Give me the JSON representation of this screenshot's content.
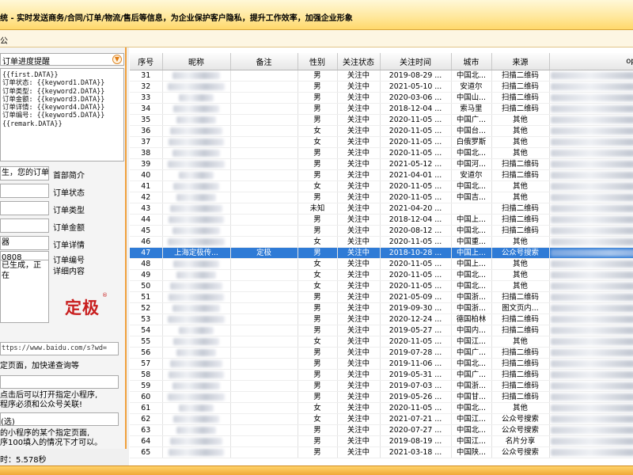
{
  "window": {
    "title": "统 - 实时发送商务/合同/订单/物流/售后等信息，为企业保护客户隐私，提升工作效率，加强企业形象",
    "menu_label": "公"
  },
  "template": {
    "selected": "订单进度提醒",
    "content": "{{first.DATA}}\n订单状态: {{keyword1.DATA}}\n订单类型: {{keyword2.DATA}}\n订单金额: {{keyword3.DATA}}\n订单详情: {{keyword4.DATA}}\n订单编号: {{keyword5.DATA}}\n{{remark.DATA}}"
  },
  "form": {
    "fields": [
      {
        "value": "生，您的订单",
        "label": "首部简介"
      },
      {
        "value": "",
        "label": "订单状态"
      },
      {
        "value": "",
        "label": "订单类型"
      },
      {
        "value": "",
        "label": "订单金额"
      },
      {
        "value": "器",
        "label": "订单详情"
      },
      {
        "value": "0808",
        "label": "订单编号"
      }
    ],
    "detail_value": "已生成，正在",
    "detail_label": "详细内容",
    "url": "ttps://www.baidu.com/s?wd=",
    "url_hint": "定页面，加快递查询等",
    "miniprogram_hint1": "点击后可以打开指定小程序,",
    "miniprogram_hint2": "程序必须和公众号关联!",
    "optional_label": "(选)",
    "page_hint1": "的小程序的某个指定页面,",
    "page_hint2": "序100填入的情况下才可以。"
  },
  "logo": {
    "text": "定极",
    "reg": "®"
  },
  "status": {
    "text": "时：5.578秒"
  },
  "table": {
    "columns": [
      "序号",
      "昵称",
      "备注",
      "性别",
      "关注状态",
      "关注时间",
      "城市",
      "来源",
      "openID"
    ],
    "rows": [
      {
        "id": "31",
        "nickname": "",
        "remark": "",
        "gender": "男",
        "status": "关注中",
        "time": "2019-08-29 ...",
        "city": "中国北...",
        "source": "扫描二维码",
        "selected": false
      },
      {
        "id": "32",
        "nickname": "",
        "remark": "",
        "gender": "男",
        "status": "关注中",
        "time": "2021-05-10 ...",
        "city": "安道尔",
        "source": "扫描二维码",
        "selected": false
      },
      {
        "id": "33",
        "nickname": "",
        "remark": "",
        "gender": "男",
        "status": "关注中",
        "time": "2020-03-06 ...",
        "city": "中国山...",
        "source": "扫描二维码",
        "selected": false
      },
      {
        "id": "34",
        "nickname": "",
        "remark": "",
        "gender": "男",
        "status": "关注中",
        "time": "2018-12-04 ...",
        "city": "索马里",
        "source": "扫描二维码",
        "selected": false
      },
      {
        "id": "35",
        "nickname": "",
        "remark": "",
        "gender": "男",
        "status": "关注中",
        "time": "2020-11-05 ...",
        "city": "中国广...",
        "source": "其他",
        "selected": false
      },
      {
        "id": "36",
        "nickname": "",
        "remark": "",
        "gender": "女",
        "status": "关注中",
        "time": "2020-11-05 ...",
        "city": "中国台...",
        "source": "其他",
        "selected": false
      },
      {
        "id": "37",
        "nickname": "",
        "remark": "",
        "gender": "女",
        "status": "关注中",
        "time": "2020-11-05 ...",
        "city": "白俄罗斯",
        "source": "其他",
        "selected": false
      },
      {
        "id": "38",
        "nickname": "",
        "remark": "",
        "gender": "男",
        "status": "关注中",
        "time": "2020-11-05 ...",
        "city": "中国北...",
        "source": "其他",
        "selected": false
      },
      {
        "id": "39",
        "nickname": "",
        "remark": "",
        "gender": "男",
        "status": "关注中",
        "time": "2021-05-12 ...",
        "city": "中国河...",
        "source": "扫描二维码",
        "selected": false
      },
      {
        "id": "40",
        "nickname": "",
        "remark": "",
        "gender": "男",
        "status": "关注中",
        "time": "2021-04-01 ...",
        "city": "安道尔",
        "source": "扫描二维码",
        "selected": false
      },
      {
        "id": "41",
        "nickname": "",
        "remark": "",
        "gender": "女",
        "status": "关注中",
        "time": "2020-11-05 ...",
        "city": "中国北...",
        "source": "其他",
        "selected": false
      },
      {
        "id": "42",
        "nickname": "",
        "remark": "",
        "gender": "男",
        "status": "关注中",
        "time": "2020-11-05 ...",
        "city": "中国吉...",
        "source": "其他",
        "selected": false
      },
      {
        "id": "43",
        "nickname": "",
        "remark": "",
        "gender": "未知",
        "status": "关注中",
        "time": "2021-04-20 ...",
        "city": "",
        "source": "扫描二维码",
        "selected": false
      },
      {
        "id": "44",
        "nickname": "",
        "remark": "",
        "gender": "男",
        "status": "关注中",
        "time": "2018-12-04 ...",
        "city": "中国上...",
        "source": "扫描二维码",
        "selected": false
      },
      {
        "id": "45",
        "nickname": "",
        "remark": "",
        "gender": "男",
        "status": "关注中",
        "time": "2020-08-12 ...",
        "city": "中国北...",
        "source": "扫描二维码",
        "selected": false
      },
      {
        "id": "46",
        "nickname": "",
        "remark": "",
        "gender": "女",
        "status": "关注中",
        "time": "2020-11-05 ...",
        "city": "中国重...",
        "source": "其他",
        "selected": false
      },
      {
        "id": "47",
        "nickname": "上海定极传...",
        "remark": "定极",
        "gender": "男",
        "status": "关注中",
        "time": "2018-10-28 ...",
        "city": "中国上...",
        "source": "公众号搜索",
        "selected": true
      },
      {
        "id": "48",
        "nickname": "",
        "remark": "",
        "gender": "女",
        "status": "关注中",
        "time": "2020-11-05 ...",
        "city": "中国上...",
        "source": "其他",
        "selected": false
      },
      {
        "id": "49",
        "nickname": "",
        "remark": "",
        "gender": "女",
        "status": "关注中",
        "time": "2020-11-05 ...",
        "city": "中国北...",
        "source": "其他",
        "selected": false
      },
      {
        "id": "50",
        "nickname": "",
        "remark": "",
        "gender": "女",
        "status": "关注中",
        "time": "2020-11-05 ...",
        "city": "中国北...",
        "source": "其他",
        "selected": false
      },
      {
        "id": "51",
        "nickname": "",
        "remark": "",
        "gender": "男",
        "status": "关注中",
        "time": "2021-05-09 ...",
        "city": "中国浙...",
        "source": "扫描二维码",
        "selected": false
      },
      {
        "id": "52",
        "nickname": "",
        "remark": "",
        "gender": "男",
        "status": "关注中",
        "time": "2019-09-30 ...",
        "city": "中国浙...",
        "source": "图文页内...",
        "selected": false
      },
      {
        "id": "53",
        "nickname": "",
        "remark": "",
        "gender": "男",
        "status": "关注中",
        "time": "2020-12-24 ...",
        "city": "德国柏林",
        "source": "扫描二维码",
        "selected": false
      },
      {
        "id": "54",
        "nickname": "",
        "remark": "",
        "gender": "男",
        "status": "关注中",
        "time": "2019-05-27 ...",
        "city": "中国内...",
        "source": "扫描二维码",
        "selected": false
      },
      {
        "id": "55",
        "nickname": "",
        "remark": "",
        "gender": "女",
        "status": "关注中",
        "time": "2020-11-05 ...",
        "city": "中国江...",
        "source": "其他",
        "selected": false
      },
      {
        "id": "56",
        "nickname": "",
        "remark": "",
        "gender": "男",
        "status": "关注中",
        "time": "2019-07-28 ...",
        "city": "中国广...",
        "source": "扫描二维码",
        "selected": false
      },
      {
        "id": "57",
        "nickname": "",
        "remark": "",
        "gender": "男",
        "status": "关注中",
        "time": "2019-11-06 ...",
        "city": "中国北...",
        "source": "扫描二维码",
        "selected": false
      },
      {
        "id": "58",
        "nickname": "",
        "remark": "",
        "gender": "男",
        "status": "关注中",
        "time": "2019-05-31 ...",
        "city": "中国广...",
        "source": "扫描二维码",
        "selected": false
      },
      {
        "id": "59",
        "nickname": "",
        "remark": "",
        "gender": "男",
        "status": "关注中",
        "time": "2019-07-03 ...",
        "city": "中国浙...",
        "source": "扫描二维码",
        "selected": false
      },
      {
        "id": "60",
        "nickname": "",
        "remark": "",
        "gender": "男",
        "status": "关注中",
        "time": "2019-05-26 ...",
        "city": "中国甘...",
        "source": "扫描二维码",
        "selected": false
      },
      {
        "id": "61",
        "nickname": "",
        "remark": "",
        "gender": "女",
        "status": "关注中",
        "time": "2020-11-05 ...",
        "city": "中国北...",
        "source": "其他",
        "selected": false
      },
      {
        "id": "62",
        "nickname": "",
        "remark": "",
        "gender": "女",
        "status": "关注中",
        "time": "2021-07-21 ...",
        "city": "中国江...",
        "source": "公众号搜索",
        "selected": false
      },
      {
        "id": "63",
        "nickname": "",
        "remark": "",
        "gender": "男",
        "status": "关注中",
        "time": "2020-07-27 ...",
        "city": "中国北...",
        "source": "公众号搜索",
        "selected": false
      },
      {
        "id": "64",
        "nickname": "",
        "remark": "",
        "gender": "男",
        "status": "关注中",
        "time": "2019-08-19 ...",
        "city": "中国江...",
        "source": "名片分享",
        "selected": false
      },
      {
        "id": "65",
        "nickname": "",
        "remark": "",
        "gender": "男",
        "status": "关注中",
        "time": "2021-03-18 ...",
        "city": "中国陕...",
        "source": "公众号搜索",
        "selected": false
      }
    ]
  }
}
